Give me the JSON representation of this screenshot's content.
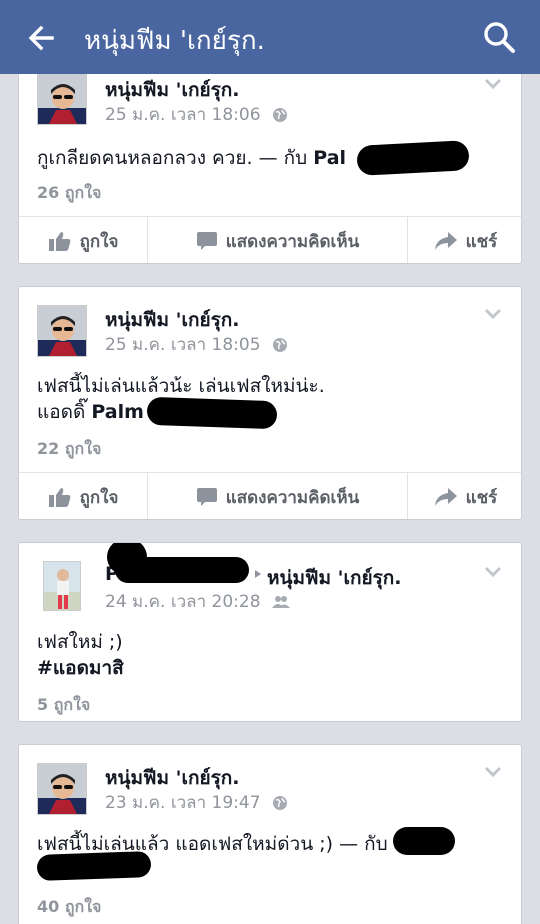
{
  "header": {
    "title": "หนุ่มฟีม 'เกย์รุก."
  },
  "actions": {
    "like": "ถูกใจ",
    "comment": "แสดงความคิดเห็น",
    "share": "แชร์"
  },
  "posts": [
    {
      "author": "หนุ่มฟีม 'เกย์รุก.",
      "time": "25 ม.ค. เวลา 18:06",
      "privacy_icon": "globe-icon",
      "text": "กูเกลียดคนหลอกลวง ควย. — กับ",
      "tag": "Pal",
      "likes": "26 ถูกใจ"
    },
    {
      "author": "หนุ่มฟีม 'เกย์รุก.",
      "time": "25 ม.ค. เวลา 18:05",
      "privacy_icon": "globe-icon",
      "text_line1": "เฟสนี้ไม่เล่นแล้วน้ะ เล่นเฟสใหม่น่ะ.",
      "text_line2": "แอดดิ๊",
      "tag": "Palm",
      "likes": "22 ถูกใจ"
    },
    {
      "author_prefix": "P",
      "author_to": "หนุ่มฟีม 'เกย์รุก.",
      "time": "24 ม.ค. เวลา 20:28",
      "privacy_icon": "friends-icon",
      "text": "เฟสใหม่ ;)",
      "hashtag": "#แอดมาสิ",
      "likes": "5 ถูกใจ"
    },
    {
      "author": "หนุ่มฟีม 'เกย์รุก.",
      "time": "23 ม.ค. เวลา 19:47",
      "privacy_icon": "globe-icon",
      "text": "เฟสนี้ไม่เล่นแล้ว แอดเฟสใหม่ด่วน ;) — กับ",
      "likes": "40 ถูกใจ"
    }
  ],
  "colors": {
    "header": "#4a66a0",
    "background": "#dcdee3",
    "muted": "#90949c"
  }
}
